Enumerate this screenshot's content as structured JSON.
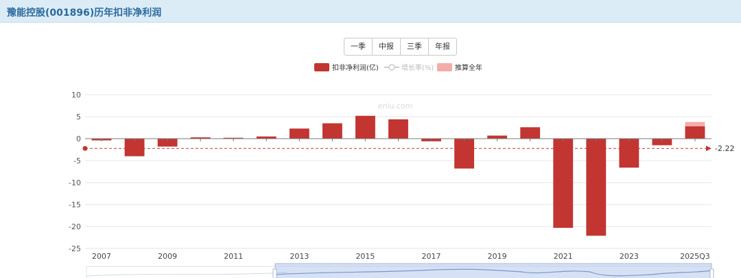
{
  "header": {
    "title": "豫能控股(001896)历年扣非净利润"
  },
  "tabs": [
    "一季",
    "中报",
    "三季",
    "年报"
  ],
  "watermark": "eniu.com",
  "colors": {
    "bar": "#c23531",
    "estimate": "#f4acab",
    "growth_legend": "#cccccc",
    "header_bg": "#dcecf7",
    "header_text": "#2b6a9c"
  },
  "chart_data": {
    "type": "bar",
    "title": "",
    "xlabel": "",
    "ylabel": "",
    "categories": [
      "2007",
      "2008",
      "2009",
      "2010",
      "2011",
      "2012",
      "2013",
      "2014",
      "2015",
      "2016",
      "2017",
      "2018",
      "2019",
      "2020",
      "2021",
      "2022",
      "2023",
      "2024",
      "2025Q3"
    ],
    "x_tick_labels": [
      "2007",
      "2009",
      "2011",
      "2013",
      "2015",
      "2017",
      "2019",
      "2021",
      "2023",
      "2025Q3"
    ],
    "ylim": [
      -25,
      10
    ],
    "yticks": [
      10,
      5,
      0,
      -5,
      -10,
      -15,
      -20,
      -25
    ],
    "grid": true,
    "legend_position": "top-center",
    "series": [
      {
        "name": "扣非净利润(亿)",
        "values": [
          -0.4,
          -4.0,
          -1.8,
          0.3,
          0.2,
          0.5,
          2.3,
          3.5,
          5.2,
          4.4,
          -0.6,
          -6.8,
          0.7,
          2.6,
          -20.3,
          -22.1,
          -6.6,
          -1.5,
          2.8
        ]
      },
      {
        "name": "增长率(%)",
        "values": []
      },
      {
        "name": "推算全年",
        "values": [
          null,
          null,
          null,
          null,
          null,
          null,
          null,
          null,
          null,
          null,
          null,
          null,
          null,
          null,
          null,
          null,
          null,
          null,
          3.8
        ]
      }
    ],
    "mark_line": {
      "value": -2.22,
      "label": "-2.22"
    }
  }
}
